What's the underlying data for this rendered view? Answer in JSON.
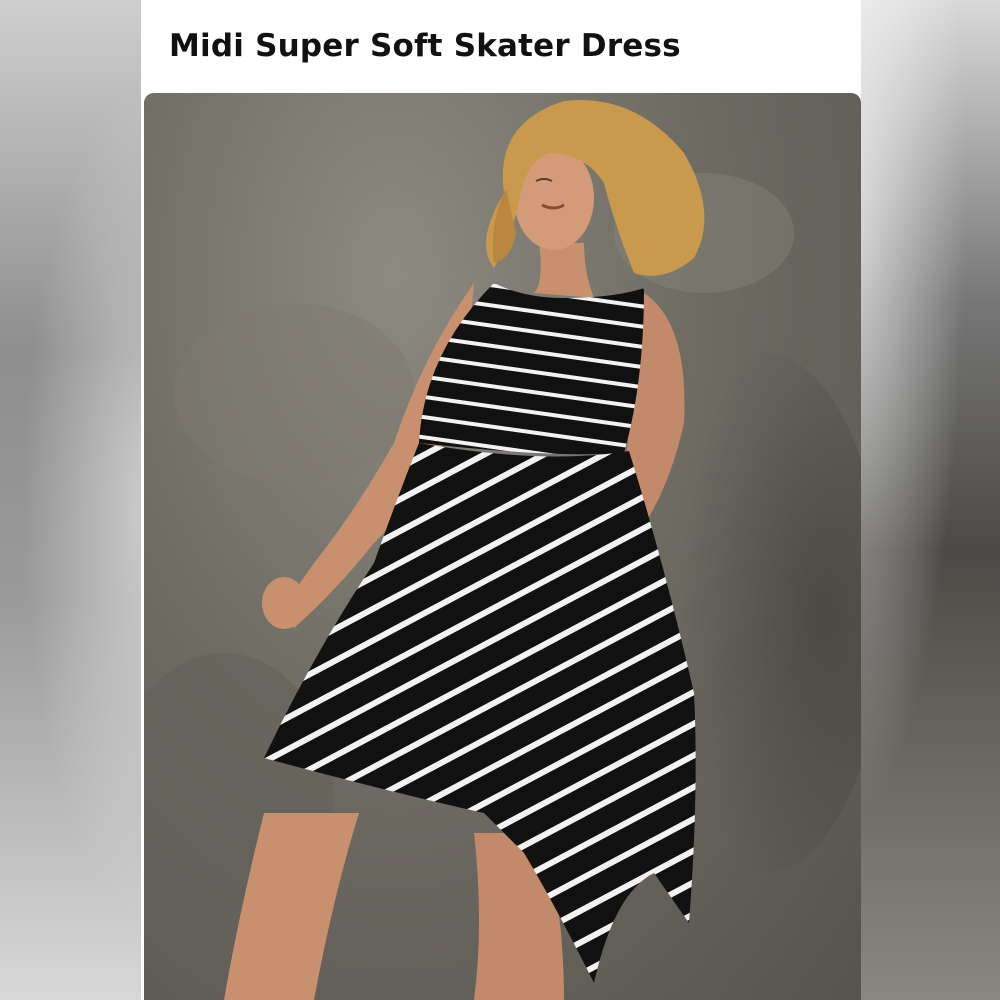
{
  "product": {
    "title": "Midi Super Soft Skater Dress",
    "image_alt": "Model wearing a black and white striped sleeveless skater dress"
  },
  "colors": {
    "dress_black": "#111111",
    "stripe_white": "#f2f2f2",
    "wall": "#6f6c64",
    "hair": "#c99a4e"
  }
}
